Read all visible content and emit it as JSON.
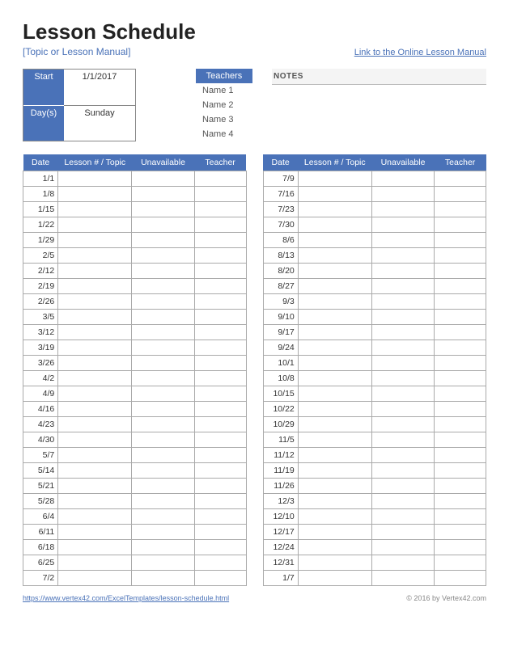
{
  "title": "Lesson Schedule",
  "subtitle": "[Topic or Lesson Manual]",
  "manual_link": "Link to the Online Lesson Manual",
  "info": {
    "start_label": "Start",
    "start_value": "1/1/2017",
    "days_label": "Day(s)",
    "days_value": "Sunday"
  },
  "teachers": {
    "header": "Teachers",
    "list": [
      "Name 1",
      "Name 2",
      "Name 3",
      "Name 4"
    ]
  },
  "notes_header": "NOTES",
  "table_headers": {
    "date": "Date",
    "lesson": "Lesson # / Topic",
    "unavailable": "Unavailable",
    "teacher": "Teacher"
  },
  "left_dates": [
    "1/1",
    "1/8",
    "1/15",
    "1/22",
    "1/29",
    "2/5",
    "2/12",
    "2/19",
    "2/26",
    "3/5",
    "3/12",
    "3/19",
    "3/26",
    "4/2",
    "4/9",
    "4/16",
    "4/23",
    "4/30",
    "5/7",
    "5/14",
    "5/21",
    "5/28",
    "6/4",
    "6/11",
    "6/18",
    "6/25",
    "7/2"
  ],
  "right_dates": [
    "7/9",
    "7/16",
    "7/23",
    "7/30",
    "8/6",
    "8/13",
    "8/20",
    "8/27",
    "9/3",
    "9/10",
    "9/17",
    "9/24",
    "10/1",
    "10/8",
    "10/15",
    "10/22",
    "10/29",
    "11/5",
    "11/12",
    "11/19",
    "11/26",
    "12/3",
    "12/10",
    "12/17",
    "12/24",
    "12/31",
    "1/7"
  ],
  "footer": {
    "url": "https://www.vertex42.com/ExcelTemplates/lesson-schedule.html",
    "copyright": "© 2016 by Vertex42.com"
  }
}
